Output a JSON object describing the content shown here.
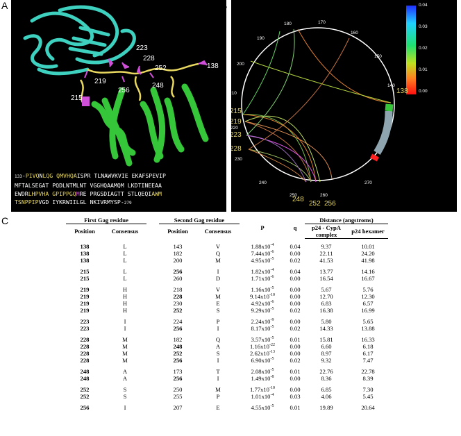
{
  "panels": {
    "a": "A",
    "b": "B",
    "c": "C"
  },
  "structure_labels": [
    "223",
    "228",
    "252",
    "138",
    "219",
    "256",
    "248",
    "215"
  ],
  "sequence": {
    "start": "133",
    "end": "279",
    "lines": [
      [
        "PIVQNLQG",
        "QMVHQAISPR",
        "TLNAWVKVIE",
        "EKAFSPEVIP"
      ],
      [
        "MFTALSEGAT",
        "PQDLNTMLNT",
        "VGGHQAAMQM",
        "LKDTINEEAA"
      ],
      [
        "EWDRLHPVHA",
        "GPIPPGQMRE",
        "PRGSDIAGTT",
        "STLQEQIAWM"
      ],
      [
        "TSNPPIPVGD",
        "IYKRWIILGL",
        "NKIVRMYSP"
      ]
    ]
  },
  "circle": {
    "ticks": [
      "180",
      "170",
      "160",
      "150",
      "140",
      "190",
      "200",
      "210",
      "220",
      "230",
      "240",
      "250",
      "260",
      "270"
    ],
    "highlight_labels": [
      "138",
      "215",
      "219",
      "223",
      "228",
      "248",
      "252",
      "256"
    ]
  },
  "colorbar": {
    "labels": [
      "0.04",
      "0.03",
      "0.02",
      "0.01",
      "0.00"
    ]
  },
  "table": {
    "group_headers": {
      "first": "First Gag residue",
      "second": "Second Gag residue",
      "p": "P",
      "q": "q",
      "distance": "Distance (angstroms)"
    },
    "sub_headers": {
      "pos1": "Position",
      "cons1": "Consensus",
      "pos2": "Position",
      "cons2": "Consensus",
      "d1": "p24 - CypA complex",
      "d2": "p24 hexamer"
    },
    "groups": [
      [
        [
          "138",
          "L",
          "143",
          "V",
          "1.88x10",
          "-4",
          "0.04",
          "9.37",
          "10.01"
        ],
        [
          "138",
          "L",
          "182",
          "Q",
          "7.44x10",
          "-6",
          "0.00",
          "22.11",
          "24.20"
        ],
        [
          "138",
          "L",
          "200",
          "M",
          "4.95x10",
          "-5",
          "0.02",
          "41.53",
          "41.98"
        ]
      ],
      [
        [
          "215",
          "L",
          "256",
          "I",
          "1.82x10",
          "-4",
          "0.04",
          "13.77",
          "14.16"
        ],
        [
          "215",
          "L",
          "260",
          "D",
          "1.71x10",
          "-6",
          "0.00",
          "16.54",
          "16.67"
        ]
      ],
      [
        [
          "219",
          "H",
          "218",
          "V",
          "1.16x10",
          "-5",
          "0.00",
          "5.67",
          "5.76"
        ],
        [
          "219",
          "H",
          "228",
          "M",
          "9.14x10",
          "-10",
          "0.00",
          "12.70",
          "12.30"
        ],
        [
          "219",
          "H",
          "230",
          "E",
          "4.92x10",
          "-6",
          "0.00",
          "6.83",
          "6.57"
        ],
        [
          "219",
          "H",
          "252",
          "S",
          "9.29x10",
          "-5",
          "0.02",
          "16.38",
          "16.99"
        ]
      ],
      [
        [
          "223",
          "I",
          "224",
          "P",
          "2.24x10",
          "-9",
          "0.00",
          "5.80",
          "5.65"
        ],
        [
          "223",
          "I",
          "256",
          "I",
          "8.17x10",
          "-5",
          "0.02",
          "14.33",
          "13.88"
        ]
      ],
      [
        [
          "228",
          "M",
          "182",
          "Q",
          "3.57x10",
          "-5",
          "0.01",
          "15.81",
          "16.33"
        ],
        [
          "228",
          "M",
          "248",
          "A",
          "1.16x10",
          "-22",
          "0.00",
          "6.60",
          "6.18"
        ],
        [
          "228",
          "M",
          "252",
          "S",
          "2.62x10",
          "-13",
          "0.00",
          "8.97",
          "6.17"
        ],
        [
          "228",
          "M",
          "256",
          "I",
          "6.90x10",
          "-5",
          "0.02",
          "9.32",
          "7.47"
        ]
      ],
      [
        [
          "248",
          "A",
          "173",
          "T",
          "2.08x10",
          "-5",
          "0.01",
          "22.76",
          "22.78"
        ],
        [
          "248",
          "A",
          "256",
          "I",
          "1.49x10",
          "-8",
          "0.00",
          "8.36",
          "8.39"
        ]
      ],
      [
        [
          "252",
          "S",
          "250",
          "M",
          "1.77x10",
          "-10",
          "0.00",
          "6.85",
          "7.30"
        ],
        [
          "252",
          "S",
          "255",
          "P",
          "1.01x10",
          "-4",
          "0.03",
          "4.06",
          "5.45"
        ]
      ],
      [
        [
          "256",
          "I",
          "207",
          "E",
          "4.55x10",
          "-5",
          "0.01",
          "19.89",
          "20.64"
        ]
      ]
    ],
    "bold_second_positions": [
      "256",
      "228",
      "252",
      "248"
    ]
  }
}
